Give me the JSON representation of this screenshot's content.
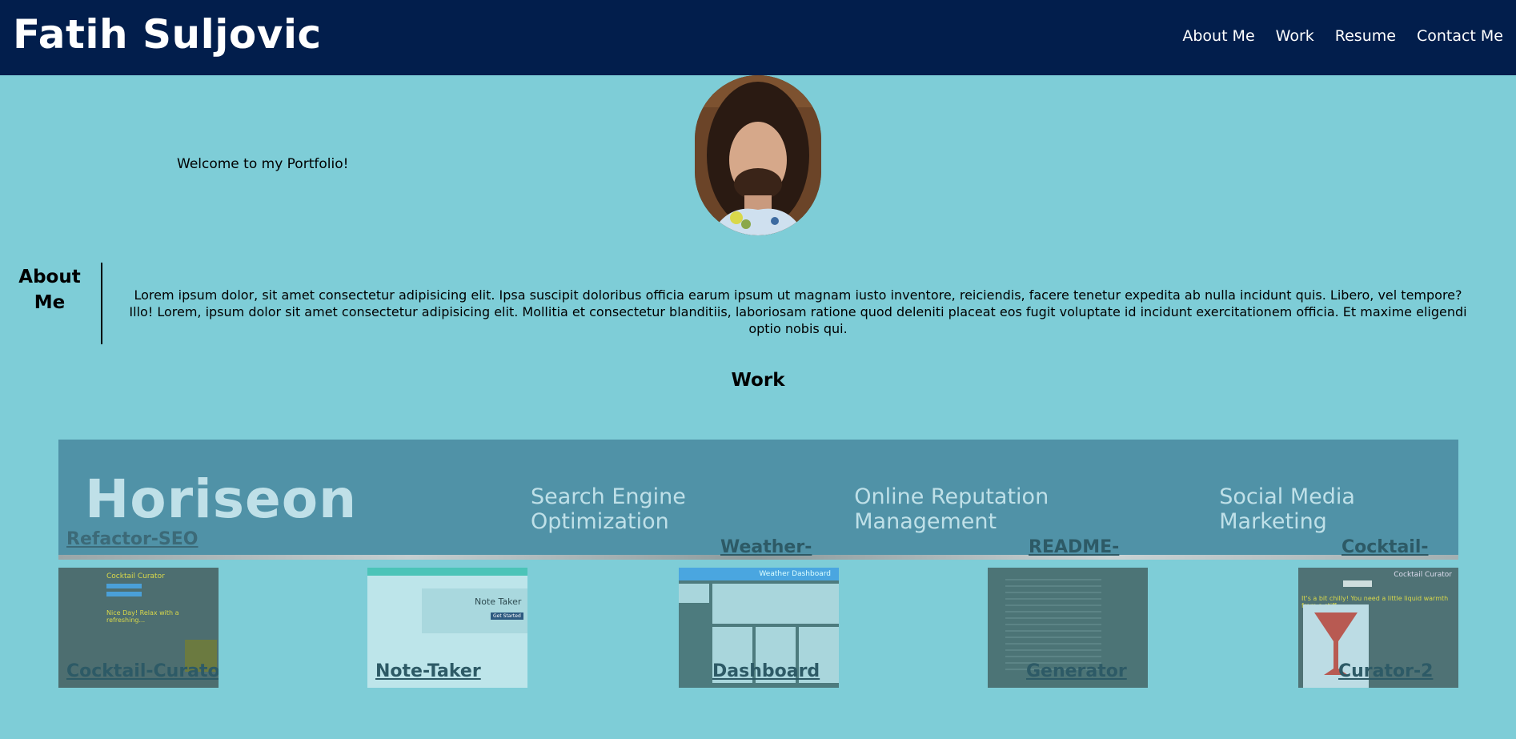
{
  "header": {
    "title": "Fatih Suljovic",
    "nav": [
      "About Me",
      "Work",
      "Resume",
      "Contact Me"
    ]
  },
  "hero": {
    "welcome": "Welcome to my Portfolio!"
  },
  "about": {
    "heading_line1": "About",
    "heading_line2": "Me",
    "text": "Lorem ipsum dolor, sit amet consectetur adipisicing elit. Ipsa suscipit doloribus officia earum ipsum ut magnam iusto inventore, reiciendis, facere tenetur expedita ab nulla incidunt quis. Libero, vel tempore? Illo! Lorem, ipsum dolor sit amet consectetur adipisicing elit. Mollitia et consectetur blanditiis, laboriosam ratione quod deleniti placeat eos fugit voluptate id incidunt exercitationem officia. Et maxime eligendi optio nobis qui."
  },
  "work": {
    "heading": "Work",
    "featured": {
      "title": "Refactor-SEO",
      "screenshot": {
        "logo": "Horiseon",
        "nav": [
          "Search Engine Optimization",
          "Online Reputation Management",
          "Social Media Marketing"
        ]
      }
    },
    "top_labels": [
      "Weather-",
      "README-",
      "Cocktail-"
    ],
    "cards": [
      {
        "label": "Cocktail-Curator",
        "shot_title": "Cocktail Curator"
      },
      {
        "label": "Note-Taker",
        "shot_title": "Note Taker"
      },
      {
        "label": "Dashboard",
        "shot_title": "Weather Dashboard"
      },
      {
        "label": "Generator",
        "shot_title": ""
      },
      {
        "label": "Curator-2",
        "shot_title": "Cocktail Curator"
      }
    ],
    "card_shots": {
      "cocktail_tagline": "Nice Day! Relax with a refreshing...",
      "notetaker_button": "Get Started",
      "curator2_tagline": "It's a bit chilly! You need a little liquid warmth from a stiff"
    }
  },
  "colors": {
    "header_bg": "#021e4c",
    "page_bg": "#7ecdd7",
    "featured_bg": "#5092a7",
    "label_color": "#2d5a66"
  }
}
